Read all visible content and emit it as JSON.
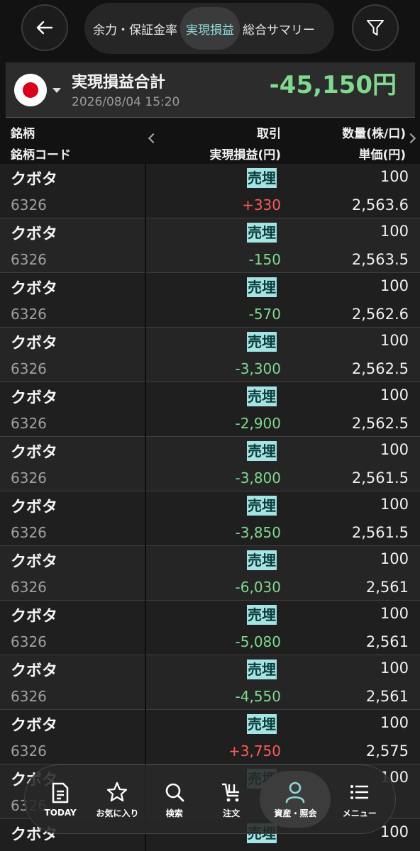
{
  "header": {
    "tabs": [
      {
        "label": "余力・保証金率"
      },
      {
        "label": "実現損益"
      },
      {
        "label": "総合サマリー"
      }
    ],
    "active_tab": "実現損益"
  },
  "summary": {
    "title": "実現損益合計",
    "datetime": "2026/08/04 15:20",
    "total": "-45,150円"
  },
  "columns": {
    "name": "銘柄",
    "code": "銘柄コード",
    "trade": "取引",
    "pl": "実現損益(円)",
    "qty": "数量(株/口)",
    "price": "単価(円)"
  },
  "rows": [
    {
      "name": "クボタ",
      "code": "6326",
      "trade": "売埋",
      "pl": "+330",
      "qty": "100",
      "price": "2,563.6"
    },
    {
      "name": "クボタ",
      "code": "6326",
      "trade": "売埋",
      "pl": "-150",
      "qty": "100",
      "price": "2,563.5"
    },
    {
      "name": "クボタ",
      "code": "6326",
      "trade": "売埋",
      "pl": "-570",
      "qty": "100",
      "price": "2,562.6"
    },
    {
      "name": "クボタ",
      "code": "6326",
      "trade": "売埋",
      "pl": "-3,300",
      "qty": "100",
      "price": "2,562.5"
    },
    {
      "name": "クボタ",
      "code": "6326",
      "trade": "売埋",
      "pl": "-2,900",
      "qty": "100",
      "price": "2,562.5"
    },
    {
      "name": "クボタ",
      "code": "6326",
      "trade": "売埋",
      "pl": "-3,800",
      "qty": "100",
      "price": "2,561.5"
    },
    {
      "name": "クボタ",
      "code": "6326",
      "trade": "売埋",
      "pl": "-3,850",
      "qty": "100",
      "price": "2,561.5"
    },
    {
      "name": "クボタ",
      "code": "6326",
      "trade": "売埋",
      "pl": "-6,030",
      "qty": "100",
      "price": "2,561"
    },
    {
      "name": "クボタ",
      "code": "6326",
      "trade": "売埋",
      "pl": "-5,080",
      "qty": "100",
      "price": "2,561"
    },
    {
      "name": "クボタ",
      "code": "6326",
      "trade": "売埋",
      "pl": "-4,550",
      "qty": "100",
      "price": "2,561"
    },
    {
      "name": "クボタ",
      "code": "6326",
      "trade": "売埋",
      "pl": "+3,750",
      "qty": "100",
      "price": "2,575"
    },
    {
      "name": "クボタ",
      "code": "6326",
      "trade": "売埋",
      "pl": "",
      "qty": "100",
      "price": ""
    },
    {
      "name": "クボタ",
      "code": "",
      "trade": "売埋",
      "pl": "",
      "qty": "100",
      "price": ""
    }
  ],
  "bottom_nav": [
    {
      "label": "TODAY",
      "icon": "today-document-icon"
    },
    {
      "label": "お気に入り",
      "icon": "star-icon"
    },
    {
      "label": "検索",
      "icon": "search-icon"
    },
    {
      "label": "注文",
      "icon": "cart-icon"
    },
    {
      "label": "資産・照会",
      "icon": "person-icon"
    },
    {
      "label": "メニュー",
      "icon": "menu-icon"
    }
  ],
  "colors": {
    "positive": "#ff5a5a",
    "negative": "#7fd98f",
    "trade_badge": "#a6e3e3",
    "active_tab_text": "#8fd8d8"
  }
}
